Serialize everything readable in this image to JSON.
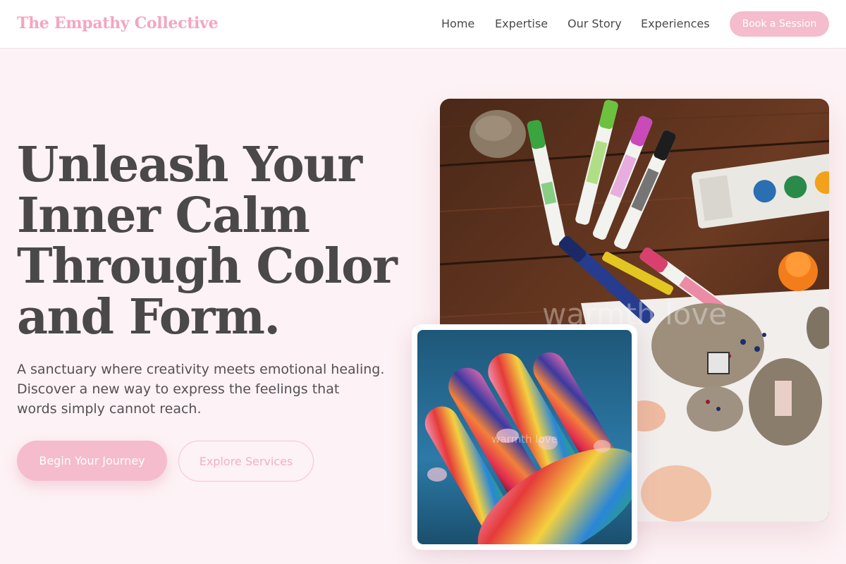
{
  "header": {
    "brand": "The Empathy Collective",
    "nav": [
      {
        "label": "Home"
      },
      {
        "label": "Expertise"
      },
      {
        "label": "Our Story"
      },
      {
        "label": "Experiences"
      }
    ],
    "cta_label": "Book a Session"
  },
  "hero": {
    "title_lines": [
      "Unleash Your",
      "Inner Calm",
      "Through Color",
      "and Form."
    ],
    "subtitle_lines": [
      "A sanctuary where creativity meets emotional healing.",
      "Discover a new way to express the feelings that",
      "words simply cannot reach."
    ],
    "primary_button": "Begin Your Journey",
    "secondary_button": "Explore Services"
  },
  "images": {
    "main_watermark": "warmth love",
    "overlay_watermark": "warmth love"
  },
  "colors": {
    "accent": "#f4bccd",
    "brand": "#f3a6bf",
    "background": "#fdf2f5",
    "text": "#4a4848"
  }
}
